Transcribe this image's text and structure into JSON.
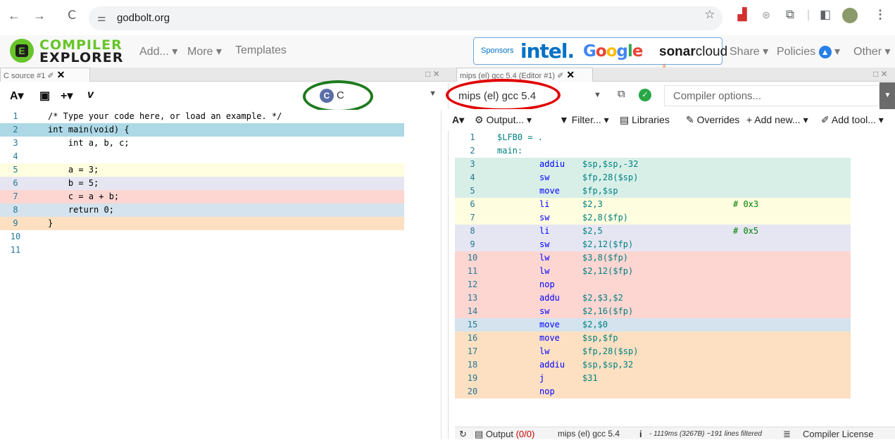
{
  "browser": {
    "back": "←",
    "forward": "→",
    "reload": "C",
    "url": "godbolt.org",
    "site_settings": "⚌"
  },
  "header": {
    "logo_top": "COMPILER",
    "logo_bottom": "EXPLORER",
    "add": "Add...",
    "more": "More",
    "templates": "Templates",
    "sponsors_label": "Sponsors",
    "sponsor_intel": "intel.",
    "sponsor_google": "Google",
    "sponsor_sonar_bold": "sonar",
    "sponsor_sonar": "cloud",
    "share": "Share",
    "policies": "Policies",
    "other": "Other"
  },
  "tabs": {
    "left": "C source #1",
    "right": "mips (el) gcc 5.4 (Editor #1)"
  },
  "left_editor": {
    "language": "C",
    "lines": [
      {
        "n": "1",
        "text": "/* Type your code here, or load an example. */",
        "kind": "comment",
        "bg": "#ffffff"
      },
      {
        "n": "2",
        "text": "int main(void) {",
        "kind": "code",
        "bg": "#add8e6"
      },
      {
        "n": "3",
        "text": "    int a, b, c;",
        "kind": "code",
        "bg": "#ffffff"
      },
      {
        "n": "4",
        "text": "",
        "kind": "code",
        "bg": "#ffffff"
      },
      {
        "n": "5",
        "text": "    a = 3;",
        "kind": "code",
        "bg": "#fffde0"
      },
      {
        "n": "6",
        "text": "    b = 5;",
        "kind": "code",
        "bg": "#e6e6f3"
      },
      {
        "n": "7",
        "text": "    c = a + b;",
        "kind": "code",
        "bg": "#fdd6d2"
      },
      {
        "n": "8",
        "text": "    return 0;",
        "kind": "code",
        "bg": "#d4e3ee"
      },
      {
        "n": "9",
        "text": "}",
        "kind": "code",
        "bg": "#fde0c2"
      },
      {
        "n": "10",
        "text": "",
        "kind": "code",
        "bg": "#ffffff"
      },
      {
        "n": "11",
        "text": "",
        "kind": "code",
        "bg": "#ffffff"
      }
    ]
  },
  "right_editor": {
    "compiler": "mips (el) gcc 5.4",
    "compiler_options_placeholder": "Compiler options...",
    "toolbar": {
      "font": "A",
      "output": "Output...",
      "filter": "Filter...",
      "libraries": "Libraries",
      "overrides": "Overrides",
      "add_new": "Add new...",
      "add_tool": "Add tool..."
    },
    "lines": [
      {
        "n": "1",
        "c1": "$LFB0 = .",
        "c2": "",
        "c3": "",
        "c4": "",
        "bg": "#ffffff"
      },
      {
        "n": "2",
        "c1": "main:",
        "c2": "",
        "c3": "",
        "c4": "",
        "bg": "#ffffff"
      },
      {
        "n": "3",
        "c1": "",
        "c2": "addiu",
        "c3": "$sp,$sp,-32",
        "c4": "",
        "bg": "#d8efe8"
      },
      {
        "n": "4",
        "c1": "",
        "c2": "sw",
        "c3": "$fp,28($sp)",
        "c4": "",
        "bg": "#d8efe8"
      },
      {
        "n": "5",
        "c1": "",
        "c2": "move",
        "c3": "$fp,$sp",
        "c4": "",
        "bg": "#d8efe8"
      },
      {
        "n": "6",
        "c1": "",
        "c2": "li",
        "c3": "$2,3",
        "c4": "# 0x3",
        "bg": "#fffde0"
      },
      {
        "n": "7",
        "c1": "",
        "c2": "sw",
        "c3": "$2,8($fp)",
        "c4": "",
        "bg": "#fffde0"
      },
      {
        "n": "8",
        "c1": "",
        "c2": "li",
        "c3": "$2,5",
        "c4": "# 0x5",
        "bg": "#e6e6f3"
      },
      {
        "n": "9",
        "c1": "",
        "c2": "sw",
        "c3": "$2,12($fp)",
        "c4": "",
        "bg": "#e6e6f3"
      },
      {
        "n": "10",
        "c1": "",
        "c2": "lw",
        "c3": "$3,8($fp)",
        "c4": "",
        "bg": "#fdd6d2"
      },
      {
        "n": "11",
        "c1": "",
        "c2": "lw",
        "c3": "$2,12($fp)",
        "c4": "",
        "bg": "#fdd6d2"
      },
      {
        "n": "12",
        "c1": "",
        "c2": "nop",
        "c3": "",
        "c4": "",
        "bg": "#fdd6d2"
      },
      {
        "n": "13",
        "c1": "",
        "c2": "addu",
        "c3": "$2,$3,$2",
        "c4": "",
        "bg": "#fdd6d2"
      },
      {
        "n": "14",
        "c1": "",
        "c2": "sw",
        "c3": "$2,16($fp)",
        "c4": "",
        "bg": "#fdd6d2"
      },
      {
        "n": "15",
        "c1": "",
        "c2": "move",
        "c3": "$2,$0",
        "c4": "",
        "bg": "#d4e3ee"
      },
      {
        "n": "16",
        "c1": "",
        "c2": "move",
        "c3": "$sp,$fp",
        "c4": "",
        "bg": "#fde0c2"
      },
      {
        "n": "17",
        "c1": "",
        "c2": "lw",
        "c3": "$fp,28($sp)",
        "c4": "",
        "bg": "#fde0c2"
      },
      {
        "n": "18",
        "c1": "",
        "c2": "addiu",
        "c3": "$sp,$sp,32",
        "c4": "",
        "bg": "#fde0c2"
      },
      {
        "n": "19",
        "c1": "",
        "c2": "j",
        "c3": "$31",
        "c4": "",
        "bg": "#fde0c2"
      },
      {
        "n": "20",
        "c1": "",
        "c2": "nop",
        "c3": "",
        "c4": "",
        "bg": "#fde0c2"
      }
    ],
    "bottom": {
      "output": "Output",
      "output_count": "(0/0)",
      "compiler": "mips (el) gcc 5.4",
      "info_icon": "i",
      "stats": "- 1119ms (3267B) ~191 lines filtered",
      "license": "Compiler License"
    }
  },
  "colors": {
    "logo_green": "#67c52a",
    "annotation_green": "#1e7a1e",
    "annotation_red": "#e00000",
    "intel_blue": "#0071c5",
    "ok_green": "#28a745"
  }
}
